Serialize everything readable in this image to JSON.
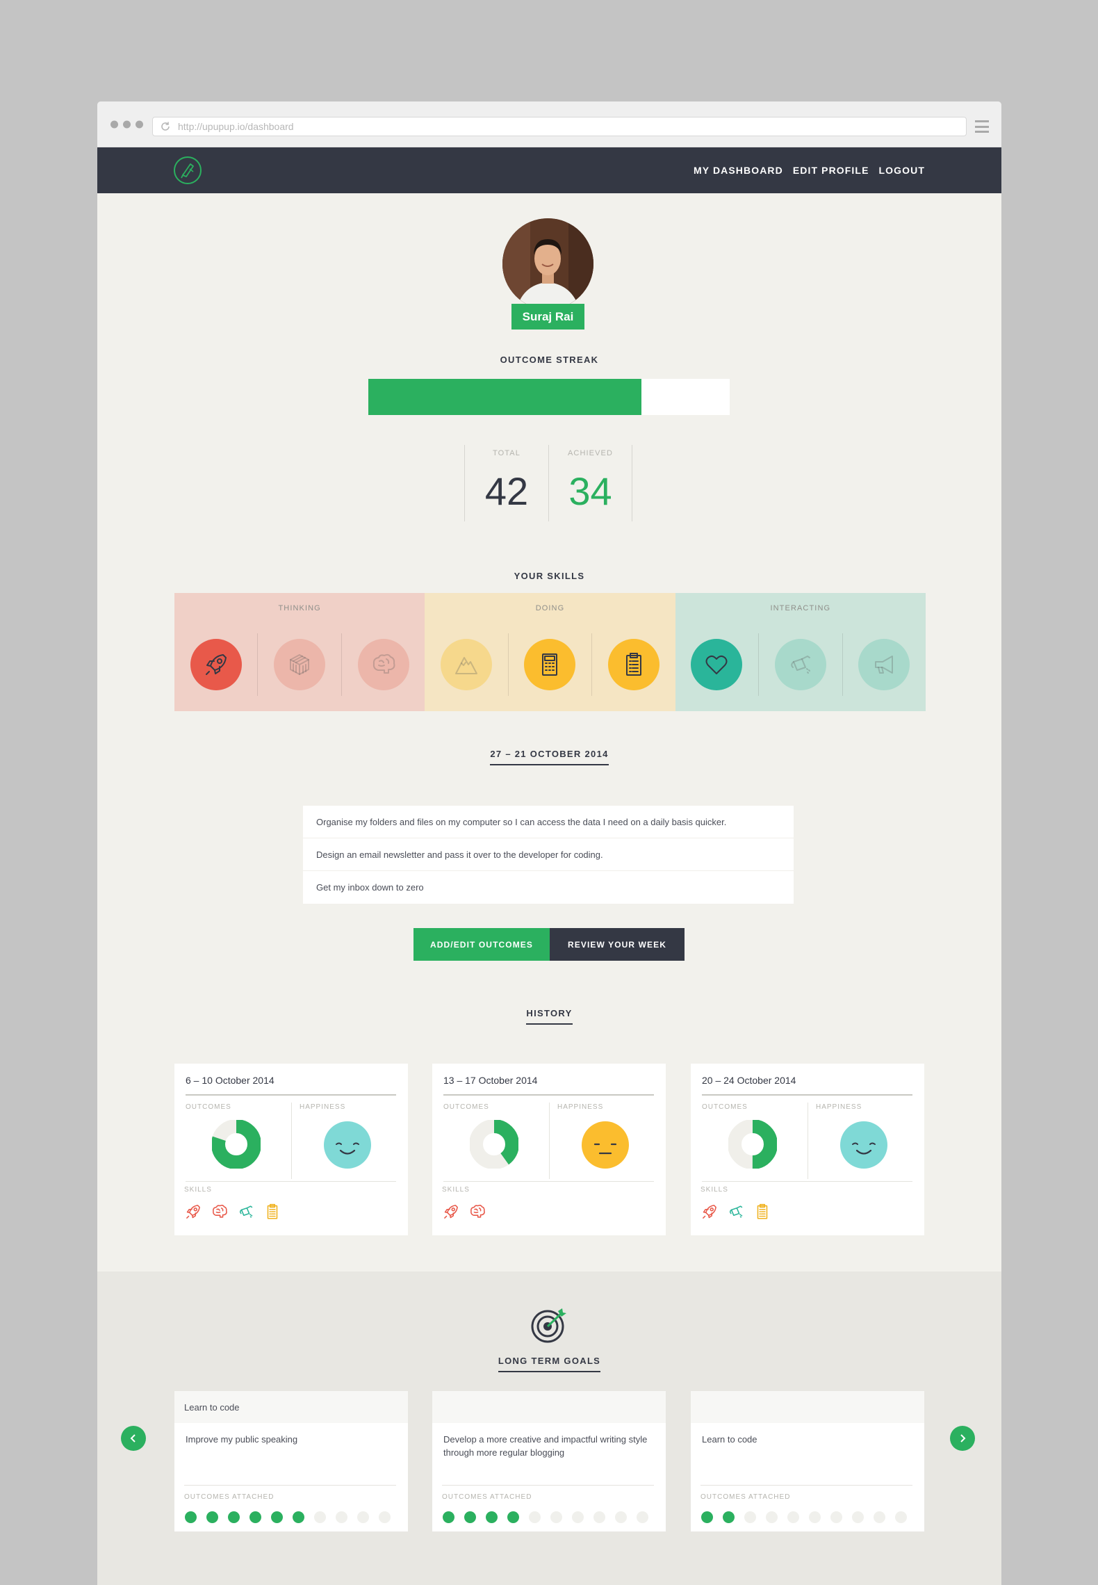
{
  "browser": {
    "url": "http://upupup.io/dashboard"
  },
  "nav": {
    "links": [
      "MY DASHBOARD",
      "EDIT PROFILE",
      "LOGOUT"
    ]
  },
  "profile": {
    "name": "Suraj Rai"
  },
  "streak": {
    "title": "OUTCOME STREAK",
    "progress_fraction": 0.755
  },
  "stats": {
    "total_label": "TOTAL",
    "total": "42",
    "achieved_label": "ACHIEVED",
    "achieved": "34"
  },
  "skills": {
    "title": "YOUR SKILLS",
    "groups": [
      {
        "label": "THINKING",
        "bg": "#f0d0c7",
        "icons": [
          {
            "name": "rocket-icon",
            "active": true,
            "color": "#e8594a"
          },
          {
            "name": "cube-icon",
            "active": false,
            "color": "#ecb6aa"
          },
          {
            "name": "brain-icon",
            "active": false,
            "color": "#ecb6aa"
          }
        ]
      },
      {
        "label": "DOING",
        "bg": "#f5e5c3",
        "icons": [
          {
            "name": "mountain-icon",
            "active": false,
            "color": "#f6d88c"
          },
          {
            "name": "calculator-icon",
            "active": true,
            "color": "#fbbd2e"
          },
          {
            "name": "clipboard-icon",
            "active": true,
            "color": "#fbbd2e"
          }
        ]
      },
      {
        "label": "INTERACTING",
        "bg": "#cce4da",
        "icons": [
          {
            "name": "heart-icon",
            "active": true,
            "color": "#2ab59a"
          },
          {
            "name": "watering-can-icon",
            "active": false,
            "color": "#a8d9cb"
          },
          {
            "name": "megaphone-icon",
            "active": false,
            "color": "#a8d9cb"
          }
        ]
      }
    ]
  },
  "week": {
    "range": "27 – 21 OCTOBER 2014"
  },
  "outcomes": [
    "Organise my folders and files on my computer so I can access the data I need on a daily basis quicker.",
    "Design an email newsletter and pass it over to the developer for coding.",
    "Get my inbox down to zero"
  ],
  "actions": {
    "add_edit": "ADD/EDIT OUTCOMES",
    "review": "REVIEW YOUR WEEK"
  },
  "history": {
    "title": "HISTORY",
    "labels": {
      "outcomes": "OUTCOMES",
      "happiness": "HAPPINESS",
      "skills": "SKILLS"
    },
    "cards": [
      {
        "range": "6 – 10 October 2014",
        "outcomes_fraction": 0.8,
        "happiness": "happy",
        "face_color": "#7fd9d6",
        "skills": [
          "rocket-icon",
          "brain-icon",
          "watering-can-icon",
          "clipboard-icon"
        ]
      },
      {
        "range": "13 – 17 October 2014",
        "outcomes_fraction": 0.4,
        "happiness": "neutral",
        "face_color": "#fbbd2e",
        "skills": [
          "rocket-icon",
          "brain-icon"
        ]
      },
      {
        "range": "20 – 24 October 2014",
        "outcomes_fraction": 0.5,
        "happiness": "happy",
        "face_color": "#7fd9d6",
        "skills": [
          "rocket-icon",
          "watering-can-icon",
          "clipboard-icon"
        ]
      }
    ]
  },
  "goals": {
    "title": "LONG TERM GOALS",
    "outcomes_label": "OUTCOMES ATTACHED",
    "cards": [
      {
        "header": "Learn to code",
        "text": "Improve my public speaking",
        "attached": 6,
        "total": 10
      },
      {
        "header": "",
        "text": "Develop a more creative and impactful writing style through more regular blogging",
        "attached": 4,
        "total": 10
      },
      {
        "header": "",
        "text": "Learn to code",
        "attached": 2,
        "total": 10
      }
    ]
  },
  "colors": {
    "green": "#2bb05f",
    "dark": "#343844",
    "background": "#f2f1ec"
  }
}
